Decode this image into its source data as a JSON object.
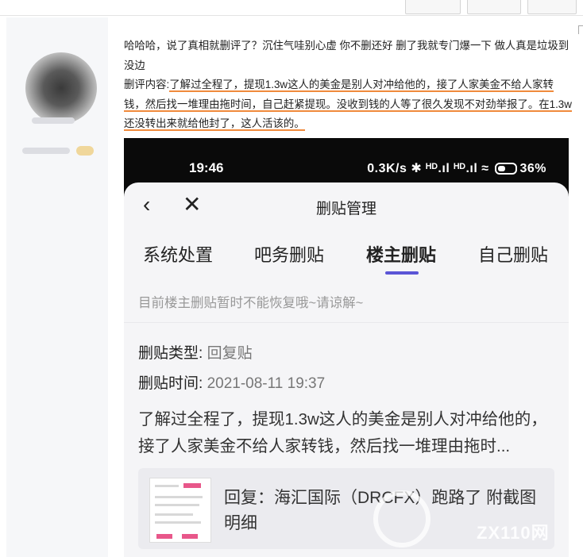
{
  "post": {
    "line1": "哈哈哈，说了真相就删评了？沉住气哇别心虚 你不删还好 删了我就专门爆一下 做人真是垃圾到没边",
    "prefix": "删评内容:",
    "deleted_highlight": "了解过全程了，提现1.3w这人的美金是别人对冲给他的，接了人家美金不给人家转钱，然后找一堆理由拖时间，自己赶紧提现。没收到钱的人等了很久发现不对劲举报了。在1.3w还没转出来就给他封了，这人活该的。"
  },
  "phone_status": {
    "time": "19:46",
    "network": "0.3K/s",
    "icons_text": "✱ ᴴᴰ.ıl ᴴᴰ.ıl ≈",
    "battery": "36%"
  },
  "sheet": {
    "title": "删贴管理",
    "tabs": [
      "系统处置",
      "吧务删贴",
      "楼主删贴",
      "自己删贴"
    ],
    "active_tab": "楼主删贴",
    "notice": "目前楼主删贴暂时不能恢复哦~请谅解~",
    "type_label": "删贴类型:",
    "type_value": "回复贴",
    "time_label": "删贴时间:",
    "time_value": "2021-08-11 19:37",
    "content": "了解过全程了，提现1.3w这人的美金是别人对冲给他的，接了人家美金不给人家转钱，然后找一堆理由拖时...",
    "reply_text": "回复：海汇国际（DRCFX）跑路了 附截图明细"
  },
  "watermark": {
    "text": "ZX110网"
  },
  "colors": {
    "underline": "#f08a3c",
    "tab_indicator": "#5b55d6"
  },
  "icons": [
    "back-icon",
    "close-icon",
    "battery-icon",
    "watermark-logo-icon"
  ]
}
